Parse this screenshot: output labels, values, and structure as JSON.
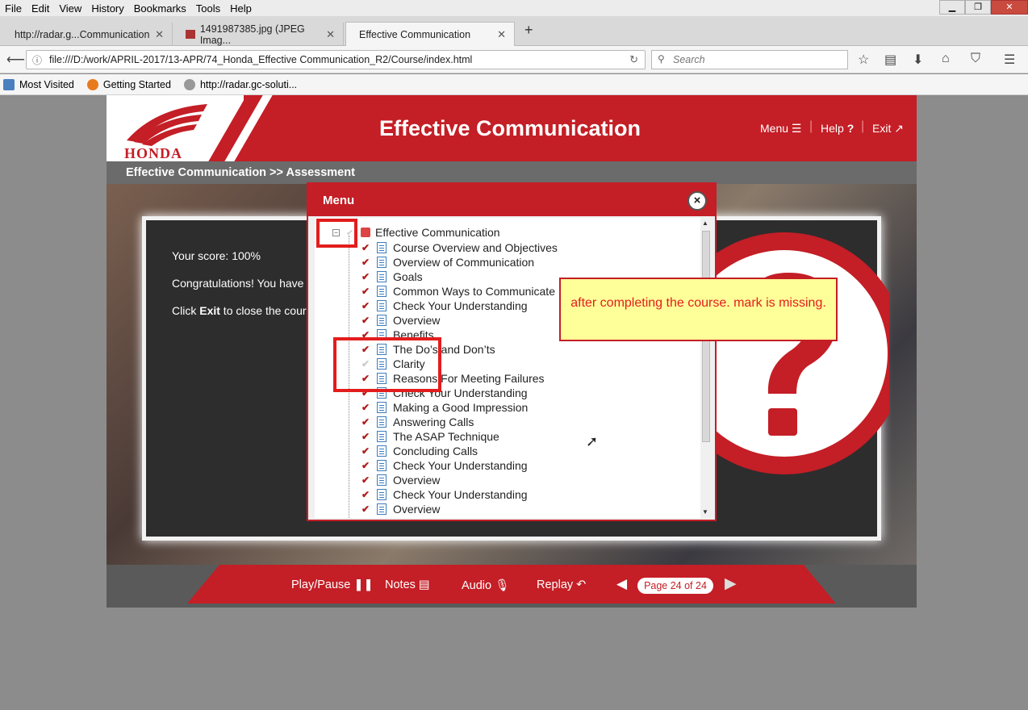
{
  "browser": {
    "menus": [
      "File",
      "Edit",
      "View",
      "History",
      "Bookmarks",
      "Tools",
      "Help"
    ],
    "tabs": [
      {
        "label": "http://radar.g...Communication"
      },
      {
        "label": "1491987385.jpg (JPEG Imag..."
      },
      {
        "label": "Effective Communication"
      }
    ],
    "url": "file:///D:/work/APRIL-2017/13-APR/74_Honda_Effective Communication_R2/Course/index.html",
    "search_placeholder": "Search",
    "bookmarks": [
      "Most Visited",
      "Getting Started",
      "http://radar.gc-soluti..."
    ]
  },
  "course": {
    "logo_text": "HONDA",
    "title": "Effective Communication",
    "nav": {
      "menu": "Menu",
      "help": "Help",
      "exit": "Exit"
    },
    "breadcrumb": "Effective Communication >> Assessment",
    "panel": {
      "score": "Your score: 100%",
      "congrats": "Congratulations! You have",
      "click_prefix": "Click ",
      "click_bold": "Exit",
      "click_suffix": " to close the cour"
    },
    "footer": {
      "play_pause": "Play/Pause",
      "notes": "Notes",
      "audio": "Audio",
      "replay": "Replay",
      "page": "Page 24 of 24"
    }
  },
  "menu_modal": {
    "title": "Menu",
    "close": "×",
    "root": "Effective Communication",
    "items": [
      {
        "label": "Course Overview and Objectives",
        "done": true
      },
      {
        "label": "Overview of Communication",
        "done": true
      },
      {
        "label": "Goals",
        "done": true
      },
      {
        "label": "Common Ways to Communicate",
        "done": true
      },
      {
        "label": "Check Your Understanding",
        "done": true
      },
      {
        "label": "Overview",
        "done": true
      },
      {
        "label": "Benefits",
        "done": true
      },
      {
        "label": "The Do’s and Don’ts",
        "done": true
      },
      {
        "label": "Clarity",
        "done": false
      },
      {
        "label": "Reasons For Meeting Failures",
        "done": true
      },
      {
        "label": "Check Your Understanding",
        "done": true
      },
      {
        "label": "Making a Good Impression",
        "done": true
      },
      {
        "label": "Answering Calls",
        "done": true
      },
      {
        "label": "The ASAP Technique",
        "done": true
      },
      {
        "label": "Concluding Calls",
        "done": true
      },
      {
        "label": "Check Your Understanding",
        "done": true
      },
      {
        "label": "Overview",
        "done": true
      },
      {
        "label": "Check Your Understanding",
        "done": true
      },
      {
        "label": "Overview",
        "done": true
      }
    ]
  },
  "annotation": {
    "note": "after completing the course. mark is missing."
  },
  "colors": {
    "brand_red": "#c41e26",
    "annotation_red": "#e31d1d",
    "note_bg": "#ffff99"
  }
}
